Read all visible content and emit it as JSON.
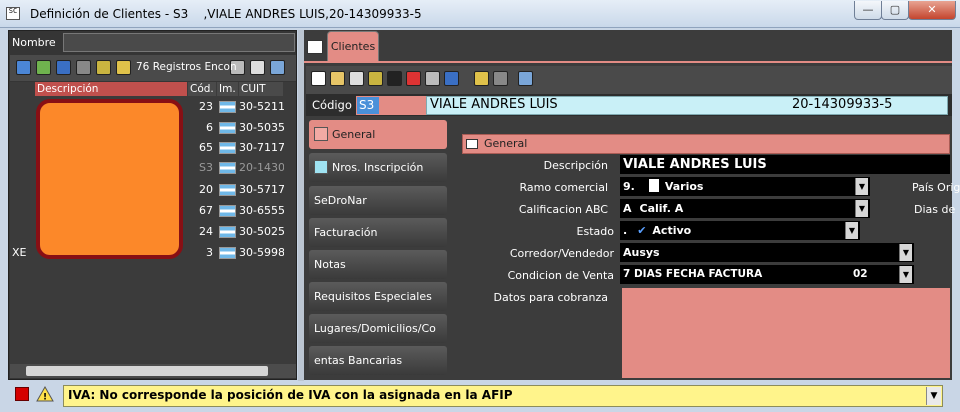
{
  "window": {
    "title": "Definición de Clientes - S3    ,VIALE ANDRES LUIS,20-14309933-5",
    "app_icon_text": "SC",
    "controls": {
      "minimize": "—",
      "maximize": "▢",
      "close": "✕"
    }
  },
  "left_panel": {
    "name_label": "Nombre",
    "name_value": "",
    "record_count": "76 Registros Encon",
    "grid": {
      "columns": [
        "Descripción",
        "Cód.",
        "Im.",
        "CUIT"
      ],
      "rows": [
        {
          "desc": "",
          "code": "23",
          "cuit": "30-5211"
        },
        {
          "desc": "",
          "code": "6",
          "cuit": "30-5035"
        },
        {
          "desc": "",
          "code": "65",
          "cuit": "30-7117"
        },
        {
          "desc": "",
          "code": "S3",
          "cuit": "20-1430"
        },
        {
          "desc": "",
          "code": "20",
          "cuit": "30-5717"
        },
        {
          "desc": "",
          "code": "67",
          "cuit": "30-6555"
        },
        {
          "desc": "",
          "code": "24",
          "cuit": "30-5025"
        },
        {
          "desc": "XE",
          "code": "3",
          "cuit": "30-5998"
        }
      ]
    }
  },
  "right_panel": {
    "tab_label": "Clientes",
    "codigo_label": "Código",
    "code": "S3",
    "client_name": "VIALE ANDRES LUIS",
    "client_cuit": "20-14309933-5",
    "nav_items": [
      "General",
      "Nros. Inscripción",
      "SeDroNar",
      "Facturación",
      "Notas",
      "Requisitos Especiales",
      "Lugares/Domicilios/Co",
      "entas Bancarias"
    ],
    "section_title": "General",
    "form": {
      "descripcion": {
        "label": "Descripción",
        "value": "VIALE ANDRES LUIS"
      },
      "ramo": {
        "label": "Ramo comercial",
        "code": "9.",
        "value": "Varios"
      },
      "calificacion": {
        "label": "Calificacion ABC",
        "code": "A",
        "value": "Calif. A"
      },
      "estado": {
        "label": "Estado",
        "code": ".",
        "value": "Activo"
      },
      "corredor": {
        "label": "Corredor/Vendedor",
        "value": "Ausys"
      },
      "condicion": {
        "label": "Condicion de Venta",
        "value": "7 DIAS FECHA FACTURA",
        "code": "02"
      },
      "datos_cobranza": {
        "label": "Datos para cobranza",
        "value": ""
      },
      "pais_label": "País Orig",
      "dias_label": "Dias de"
    }
  },
  "status": {
    "message": "IVA: No corresponde la posición de IVA con la asignada en la AFIP",
    "colors": {
      "accent": "#e38c85",
      "warning_bg": "#fff48b",
      "redaction": "#fc8829"
    }
  }
}
